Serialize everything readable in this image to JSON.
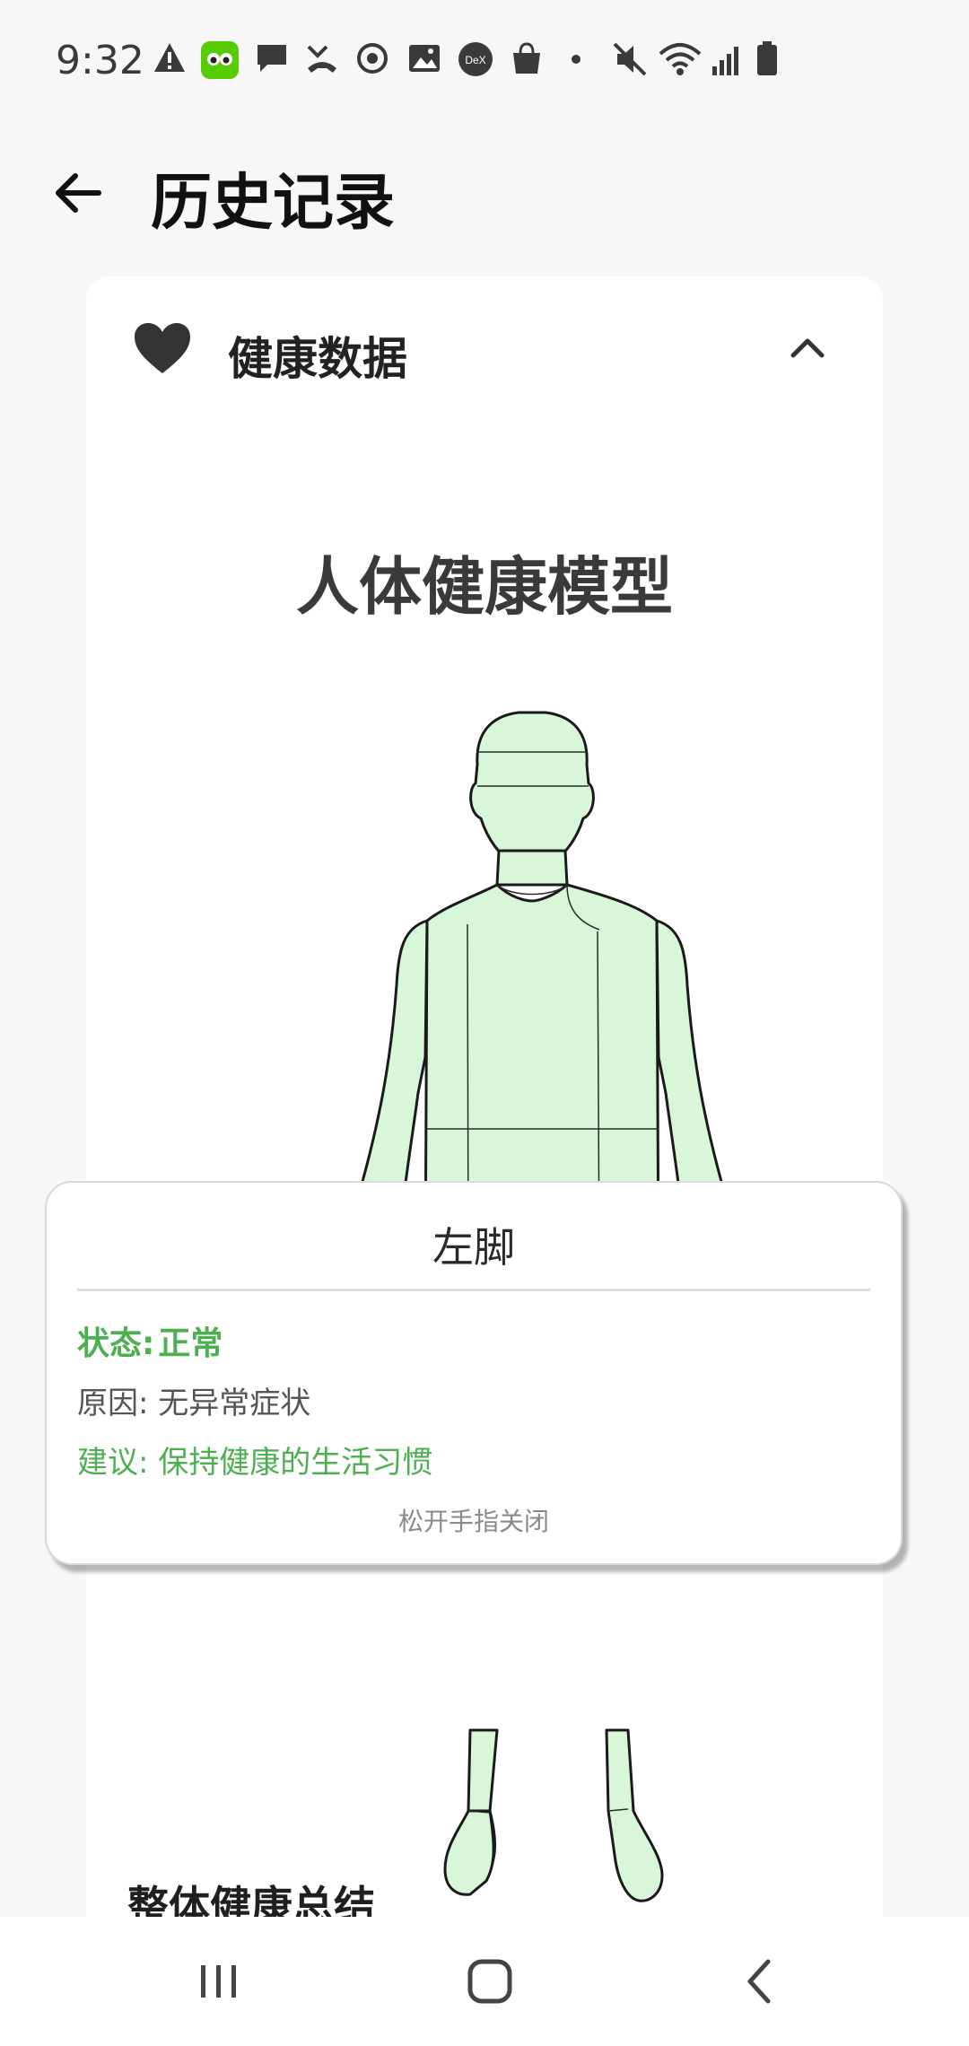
{
  "status_bar": {
    "time": "9:32",
    "icons": [
      "warning-icon",
      "duolingo-app-icon",
      "message-icon",
      "missed-call-icon",
      "sync-icon",
      "gallery-icon",
      "dex-icon",
      "shopping-bag-icon",
      "dot-icon",
      "mute-icon",
      "wifi-icon",
      "signal-icon",
      "battery-icon"
    ]
  },
  "app_bar": {
    "title": "历史记录",
    "back_icon": "arrow-left-icon"
  },
  "card": {
    "title": "健康数据",
    "icon": "heart-icon",
    "chevron": "chevron-up-icon",
    "model_title": "人体健康模型",
    "summary_heading": "整体健康总结"
  },
  "popup": {
    "title": "左脚",
    "status_label": "状态:",
    "status_value": "正常",
    "reason": "原因: 无异常症状",
    "advice": "建议: 保持健康的生活习惯",
    "hint": "松开手指关闭"
  },
  "colors": {
    "healthy_fill": "#d8f7d8",
    "outline": "#1a1a1a",
    "status_green": "#4caf50",
    "card_bg": "#ffffff",
    "page_bg": "#f7f7f7"
  },
  "nav_bar": {
    "recent": "recent-apps-icon",
    "home": "home-icon",
    "back": "back-icon"
  }
}
